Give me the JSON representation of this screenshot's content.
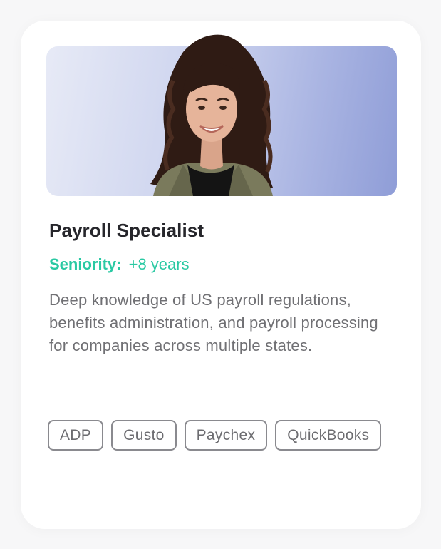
{
  "card": {
    "title": "Payroll Specialist",
    "seniority_label": "Seniority:",
    "seniority_value": "+8 years",
    "description": "Deep knowledge of US payroll regulations, benefits administration, and payroll processing for companies across multiple states.",
    "tags": [
      "ADP",
      "Gusto",
      "Paychex",
      "QuickBooks"
    ]
  },
  "colors": {
    "accent": "#2ac9a3",
    "title": "#26262b",
    "body_text": "#707074",
    "tag_border": "#8a8a8f",
    "photo_gradient_start": "#e7eaf6",
    "photo_gradient_end": "#8f9dd7"
  }
}
